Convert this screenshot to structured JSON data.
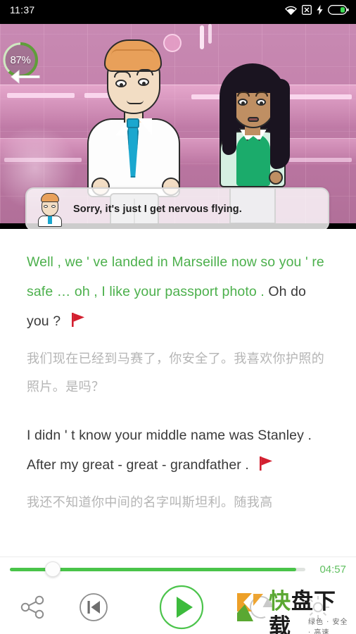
{
  "statusbar": {
    "time": "11:37",
    "icons": [
      "wifi-icon",
      "no-sim-icon",
      "charging-bolt-icon",
      "battery-icon"
    ]
  },
  "video": {
    "progress_badge": "87%",
    "back_icon": "back-arrow-icon",
    "subtitle": "Sorry, it's just I get nervous flying.",
    "avatar_name": "speaker-avatar"
  },
  "transcript": {
    "paragraphs": [
      {
        "en_spoken": "Well , we ' ve landed in Marseille now so you ' re safe … oh , I like your passport photo .",
        "en_rest": "Oh do you ?",
        "flag": "red-flag-icon",
        "cn": "我们现在已经到马赛了，你安全了。我喜欢你护照的照片。是吗？"
      },
      {
        "en_spoken": "",
        "en_rest": "I didn ' t know your middle name was Stanley . After my great - great - grandfather .",
        "flag": "red-flag-icon",
        "cn": "我还不知道你中间的名字叫斯坦利。随我高"
      }
    ]
  },
  "player": {
    "time_remaining": "04:57",
    "progress_percent": 15,
    "buttons": {
      "share": "share-icon",
      "previous": "previous-track-icon",
      "play": "play-icon",
      "repeat": "repeat-icon",
      "settings": "gear-icon"
    }
  },
  "watermark": {
    "text_1": "快",
    "text_2": "盘下载",
    "tagline": "绿色 · 安全 · 高速"
  },
  "colors": {
    "accent_green": "#4cb04c",
    "seek_green": "#49c449",
    "flag_red": "#d32030",
    "cn_gray": "#b5b5b5",
    "en_dark": "#3a3a3a"
  }
}
